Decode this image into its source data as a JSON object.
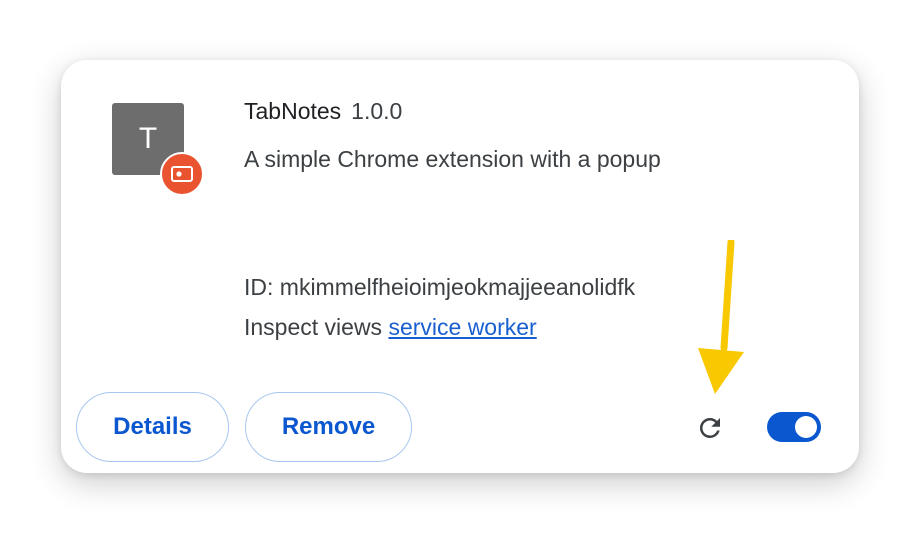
{
  "extension": {
    "icon_letter": "T",
    "name": "TabNotes",
    "version": "1.0.0",
    "description": "A simple Chrome extension with a popup",
    "id_line": "ID: mkimmelfheioimjeokmajjeeanolidfk",
    "inspect_label": "Inspect views",
    "inspect_link": "service worker",
    "enabled": true
  },
  "actions": {
    "details_label": "Details",
    "remove_label": "Remove"
  },
  "icons": {
    "reload": "reload-icon",
    "badge": "unpacked-badge-icon",
    "annotation": "arrow-annotation-icon"
  },
  "colors": {
    "accent": "#0b57d0",
    "badge": "#ea5330",
    "arrow": "#f8c800"
  }
}
